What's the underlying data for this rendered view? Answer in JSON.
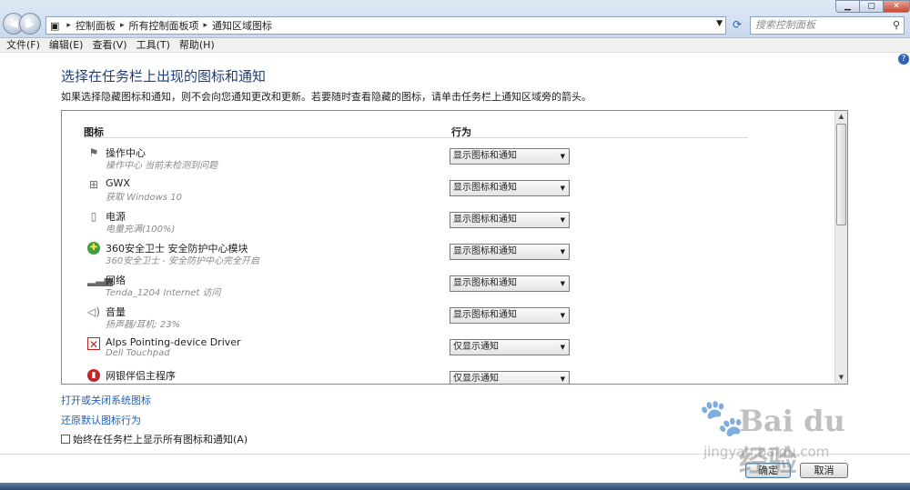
{
  "address": {
    "segments": [
      "控制面板",
      "所有控制面板项",
      "通知区域图标"
    ]
  },
  "search": {
    "placeholder": "搜索控制面板"
  },
  "menu": {
    "items": [
      "文件(F)",
      "编辑(E)",
      "查看(V)",
      "工具(T)",
      "帮助(H)"
    ]
  },
  "page": {
    "title": "选择在任务栏上出现的图标和通知",
    "description": "如果选择隐藏图标和通知，则不会向您通知更改和更新。若要随时查看隐藏的图标，请单击任务栏上通知区域旁的箭头。"
  },
  "table": {
    "col_icon": "图标",
    "col_behavior": "行为",
    "rows": [
      {
        "name": "操作中心",
        "sub": "操作中心  当前未检测到问题",
        "behavior": "显示图标和通知",
        "icon": "flag-icon"
      },
      {
        "name": "GWX",
        "sub": "获取 Windows 10",
        "behavior": "显示图标和通知",
        "icon": "windows-icon"
      },
      {
        "name": "电源",
        "sub": "电量充满(100%)",
        "behavior": "显示图标和通知",
        "icon": "battery-icon"
      },
      {
        "name": "360安全卫士 安全防护中心模块",
        "sub": "360安全卫士 - 安全防护中心完全开启",
        "behavior": "显示图标和通知",
        "icon": "360-icon"
      },
      {
        "name": "网络",
        "sub": "Tenda_1204 Internet 访问",
        "behavior": "显示图标和通知",
        "icon": "network-icon"
      },
      {
        "name": "音量",
        "sub": "扬声器/耳机: 23%",
        "behavior": "显示图标和通知",
        "icon": "speaker-icon"
      },
      {
        "name": "Alps Pointing-device Driver",
        "sub": "Dell Touchpad",
        "behavior": "仅显示通知",
        "icon": "touchpad-icon"
      },
      {
        "name": "网银伴侣主程序",
        "sub": "",
        "behavior": "仅显示通知",
        "icon": "bank-icon"
      }
    ]
  },
  "links": {
    "system_icons": "打开或关闭系统图标",
    "restore": "还原默认图标行为"
  },
  "checkbox": {
    "label": "始终在任务栏上显示所有图标和通知(A)"
  },
  "buttons": {
    "ok": "确定",
    "cancel": "取消"
  },
  "watermark": {
    "brand": "Bai du 经验",
    "url": "jingyan.baidu.com"
  },
  "colors": {
    "title": "#1f3e7a",
    "link": "#1f5fb4",
    "titlebar": "#c9d9ee"
  }
}
